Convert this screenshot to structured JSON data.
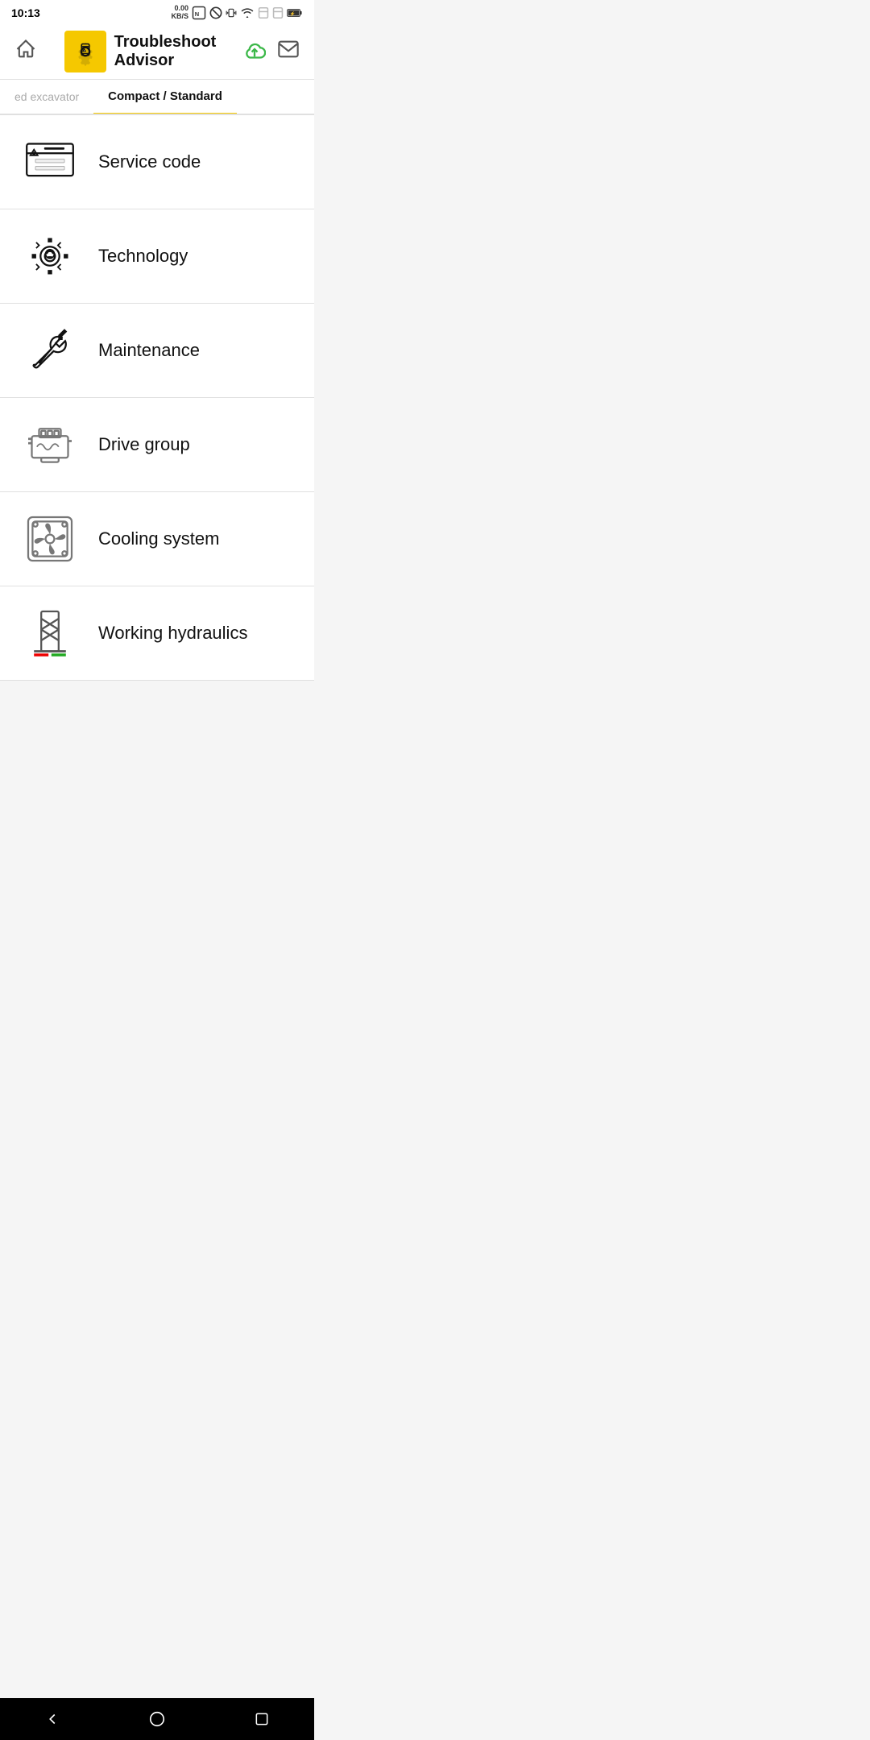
{
  "statusBar": {
    "time": "10:13",
    "netSpeed": "0.00\nKB/S"
  },
  "header": {
    "appName": "Troubleshoot\nAdvisor",
    "homeLabel": "home",
    "cloudLabel": "cloud",
    "mailLabel": "mail"
  },
  "tabs": [
    {
      "id": "tracked",
      "label": "ed excavator",
      "active": false
    },
    {
      "id": "compact",
      "label": "Compact / Standard",
      "active": true
    }
  ],
  "menuItems": [
    {
      "id": "service-code",
      "label": "Service code",
      "icon": "service-code-icon"
    },
    {
      "id": "technology",
      "label": "Technology",
      "icon": "technology-icon"
    },
    {
      "id": "maintenance",
      "label": "Maintenance",
      "icon": "maintenance-icon"
    },
    {
      "id": "drive-group",
      "label": "Drive group",
      "icon": "drive-group-icon"
    },
    {
      "id": "cooling-system",
      "label": "Cooling system",
      "icon": "cooling-system-icon"
    },
    {
      "id": "working-hydraulics",
      "label": "Working hydraulics",
      "icon": "working-hydraulics-icon"
    }
  ],
  "bottomNav": {
    "back": "◁",
    "home": "○",
    "recent": "□"
  },
  "colors": {
    "accent": "#f5c800",
    "cloudGreen": "#3cb849"
  }
}
